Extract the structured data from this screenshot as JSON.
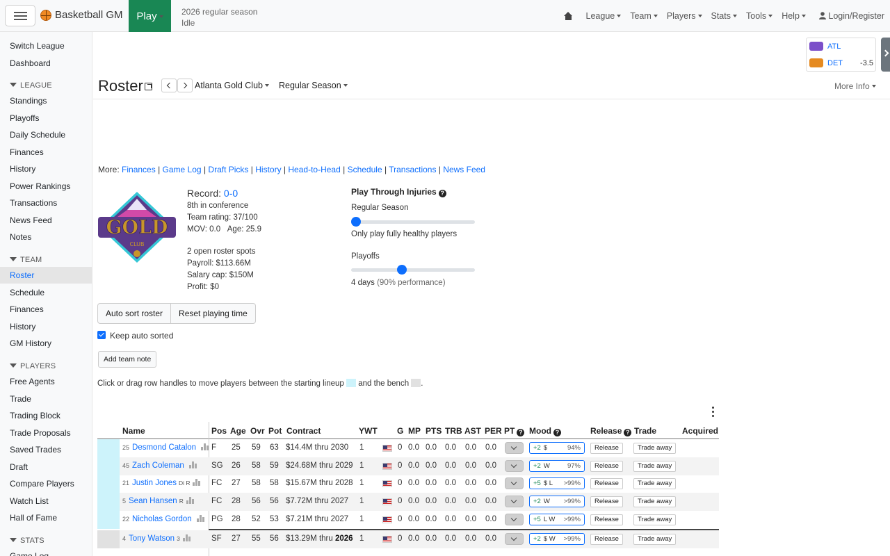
{
  "navbar": {
    "brand": "Basketball GM",
    "play_label": "Play",
    "status_line1": "2026 regular season",
    "status_line2": "Idle",
    "menus": [
      "League",
      "Team",
      "Players",
      "Stats",
      "Tools",
      "Help"
    ],
    "login": "Login/Register"
  },
  "sidebar": {
    "top": [
      "Switch League",
      "Dashboard"
    ],
    "league_header": "LEAGUE",
    "league": [
      "Standings",
      "Playoffs",
      "Daily Schedule",
      "Finances",
      "History",
      "Power Rankings",
      "Transactions",
      "News Feed",
      "Notes"
    ],
    "team_header": "TEAM",
    "team": [
      "Roster",
      "Schedule",
      "Finances",
      "History",
      "GM History"
    ],
    "players_header": "PLAYERS",
    "players": [
      "Free Agents",
      "Trade",
      "Trading Block",
      "Trade Proposals",
      "Saved Trades",
      "Draft",
      "Compare Players",
      "Watch List",
      "Hall of Fame"
    ],
    "stats_header": "STATS",
    "stats": [
      "Game Log"
    ]
  },
  "scoreboard": {
    "team1": "ATL",
    "team2": "DET",
    "spread": "-3.5",
    "colors": {
      "atl": "#7b4fc9",
      "det": "#1f4fa8"
    }
  },
  "page": {
    "title": "Roster",
    "team_select": "Atlanta Gold Club",
    "season_select": "Regular Season",
    "more_info": "More Info",
    "more_prefix": "More:",
    "more_links": [
      "Finances",
      "Game Log",
      "Draft Picks",
      "History",
      "Head-to-Head",
      "Schedule",
      "Transactions",
      "News Feed"
    ]
  },
  "logo": {
    "word": "GOLD",
    "sub": "CLUB",
    "colors": {
      "gold": "#c8962a",
      "purple": "#5b3a8a",
      "teal": "#35c7d6",
      "magenta": "#d14aa8"
    }
  },
  "team_info": {
    "record_label": "Record:",
    "record_value": "0-0",
    "conf": "8th in conference",
    "rating": "Team rating: 37/100",
    "mov": "MOV: 0.0",
    "age": "Age: 25.9",
    "roster_spots": "2 open roster spots",
    "payroll": "Payroll: $113.66M",
    "cap": "Salary cap: $150M",
    "profit": "Profit: $0"
  },
  "injuries": {
    "title": "Play Through Injuries",
    "regular_label": "Regular Season",
    "regular_value": 0,
    "regular_desc": "Only play fully healthy players",
    "playoffs_label": "Playoffs",
    "playoffs_value": 4,
    "playoffs_max": 10,
    "playoffs_desc_main": "4 days",
    "playoffs_desc_sub": "(90% performance)"
  },
  "buttons": {
    "auto_sort": "Auto sort roster",
    "reset_pt": "Reset playing time",
    "keep_sorted": "Keep auto sorted",
    "add_note": "Add team note"
  },
  "instructions": {
    "text1": "Click or drag row handles to move players between the starting lineup",
    "text2": "and the bench",
    "text3": ".",
    "starter_color": "#cdf3fb",
    "bench_color": "#e1e1e1"
  },
  "table": {
    "headers": [
      "Name",
      "Pos",
      "Age",
      "Ovr",
      "Pot",
      "Contract",
      "YWT",
      "G",
      "MP",
      "PTS",
      "TRB",
      "AST",
      "PER",
      "PT",
      "Mood",
      "Release",
      "Trade",
      "Acquired"
    ],
    "rows": [
      {
        "rank": "25",
        "name": "Desmond Catalon",
        "skills": "",
        "pos": "F",
        "age": "25",
        "ovr": "59",
        "pot": "63",
        "contract_amt": "$14.4M thru",
        "contract_year": "2030",
        "ywt": "1",
        "g": "0",
        "mp": "0.0",
        "pts": "0.0",
        "trb": "0.0",
        "ast": "0.0",
        "per": "0.0",
        "mood_trait": "+2",
        "mood_sym": "$",
        "mood_pct": "94%",
        "release": "Release",
        "trade": "Trade away",
        "starter": true
      },
      {
        "rank": "45",
        "name": "Zach Coleman",
        "skills": "",
        "pos": "SG",
        "age": "26",
        "ovr": "58",
        "pot": "59",
        "contract_amt": "$24.68M thru",
        "contract_year": "2029",
        "ywt": "1",
        "g": "0",
        "mp": "0.0",
        "pts": "0.0",
        "trb": "0.0",
        "ast": "0.0",
        "per": "0.0",
        "mood_trait": "+2",
        "mood_sym": "W",
        "mood_pct": "97%",
        "release": "Release",
        "trade": "Trade away",
        "starter": true
      },
      {
        "rank": "21",
        "name": "Justin Jones",
        "skills": "Di R",
        "pos": "FC",
        "age": "27",
        "ovr": "58",
        "pot": "58",
        "contract_amt": "$15.67M thru",
        "contract_year": "2028",
        "ywt": "1",
        "g": "0",
        "mp": "0.0",
        "pts": "0.0",
        "trb": "0.0",
        "ast": "0.0",
        "per": "0.0",
        "mood_trait": "+5",
        "mood_sym": "$ L",
        "mood_pct": ">99%",
        "release": "Release",
        "trade": "Trade away",
        "starter": true
      },
      {
        "rank": "5",
        "name": "Sean Hansen",
        "skills": "R",
        "pos": "FC",
        "age": "28",
        "ovr": "56",
        "pot": "56",
        "contract_amt": "$7.72M thru",
        "contract_year": "2027",
        "ywt": "1",
        "g": "0",
        "mp": "0.0",
        "pts": "0.0",
        "trb": "0.0",
        "ast": "0.0",
        "per": "0.0",
        "mood_trait": "+2",
        "mood_sym": "W",
        "mood_pct": ">99%",
        "release": "Release",
        "trade": "Trade away",
        "starter": true
      },
      {
        "rank": "22",
        "name": "Nicholas Gordon",
        "skills": "",
        "pos": "PG",
        "age": "28",
        "ovr": "52",
        "pot": "53",
        "contract_amt": "$7.21M thru",
        "contract_year": "2027",
        "ywt": "1",
        "g": "0",
        "mp": "0.0",
        "pts": "0.0",
        "trb": "0.0",
        "ast": "0.0",
        "per": "0.0",
        "mood_trait": "+5",
        "mood_sym": "L W",
        "mood_pct": ">99%",
        "release": "Release",
        "trade": "Trade away",
        "starter": true
      },
      {
        "rank": "4",
        "name": "Tony Watson",
        "skills": "3",
        "pos": "SF",
        "age": "27",
        "ovr": "55",
        "pot": "56",
        "contract_amt": "$13.29M thru",
        "contract_year": "2026",
        "ywt": "1",
        "g": "0",
        "mp": "0.0",
        "pts": "0.0",
        "trb": "0.0",
        "ast": "0.0",
        "per": "0.0",
        "mood_trait": "+2",
        "mood_sym": "$ W",
        "mood_pct": ">99%",
        "release": "Release",
        "trade": "Trade away",
        "starter": false
      }
    ]
  }
}
